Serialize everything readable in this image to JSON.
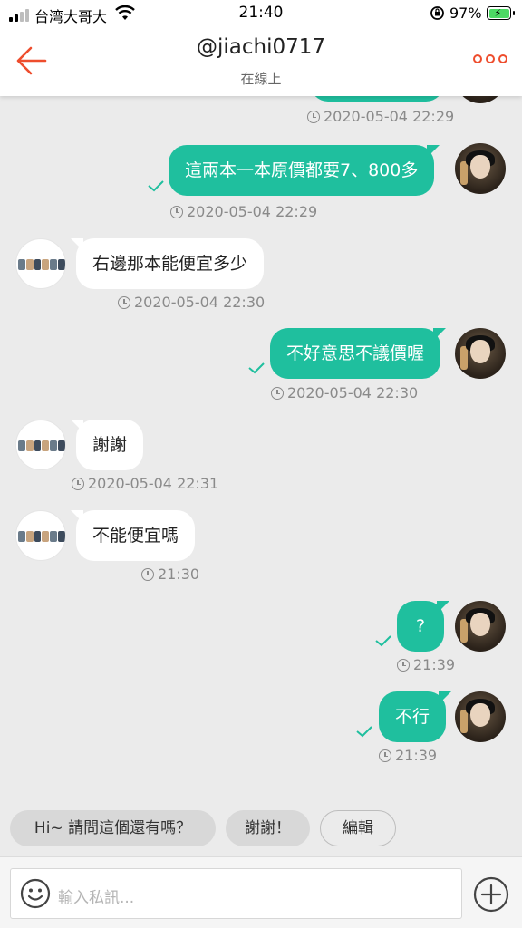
{
  "status_bar": {
    "carrier": "台湾大哥大",
    "time": "21:40",
    "battery": "97%"
  },
  "header": {
    "title": "@jiachi0717",
    "subtitle": "在線上"
  },
  "messages": [
    {
      "from": "me",
      "text": "",
      "time": "2020-05-04 22:29"
    },
    {
      "from": "me",
      "text": "這兩本一本原價都要7、800多",
      "time": "2020-05-04 22:29"
    },
    {
      "from": "them",
      "text": "右邊那本能便宜多少",
      "time": "2020-05-04 22:30"
    },
    {
      "from": "me",
      "text": "不好意思不議價喔",
      "time": "2020-05-04 22:30"
    },
    {
      "from": "them",
      "text": "謝謝",
      "time": "2020-05-04 22:31"
    },
    {
      "from": "them",
      "text": "不能便宜嗎",
      "time": "21:30"
    },
    {
      "from": "me",
      "text": "?",
      "time": "21:39"
    },
    {
      "from": "me",
      "text": "不行",
      "time": "21:39"
    }
  ],
  "quick_replies": [
    "Hi~ 請問這個還有嗎？",
    "謝謝！",
    "編輯"
  ],
  "composer": {
    "placeholder": "輸入私訊..."
  },
  "colors": {
    "accent": "#ee4d2d",
    "outgoing_bubble": "#1fbf9e"
  }
}
